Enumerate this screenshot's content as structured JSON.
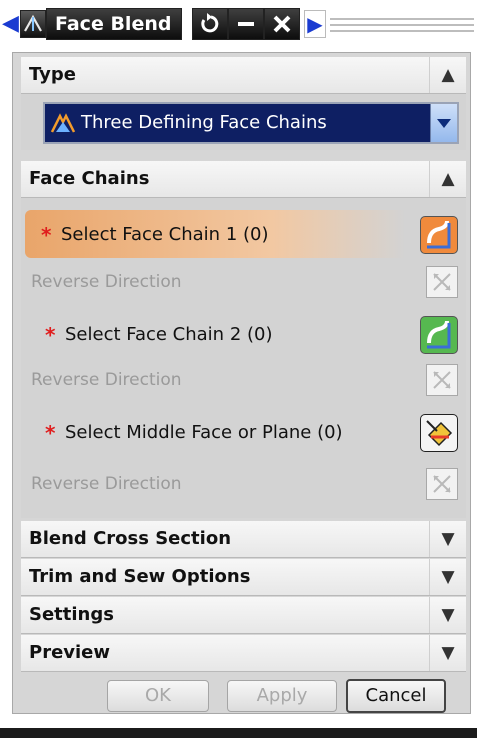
{
  "window": {
    "title": "Face Blend",
    "back_icon": "chevron-left-icon",
    "more_icon": "chevron-right-icon",
    "buttons": [
      "reset-icon",
      "minimize-icon",
      "close-icon"
    ]
  },
  "sections": {
    "type": {
      "label": "Type",
      "expanded": true,
      "dropdown": {
        "value": "Three Defining Face Chains",
        "icon": "face-blend-icon"
      }
    },
    "face_chains": {
      "label": "Face Chains",
      "expanded": true,
      "chain1": {
        "label": "Select Face Chain 1 (0)",
        "required_mark": "*",
        "active": true
      },
      "reverse1": {
        "label": "Reverse Direction"
      },
      "chain2": {
        "label": "Select Face Chain 2 (0)",
        "required_mark": "*"
      },
      "reverse2": {
        "label": "Reverse Direction"
      },
      "middle": {
        "label": "Select Middle Face or Plane (0)",
        "required_mark": "*"
      },
      "reverse3": {
        "label": "Reverse Direction"
      }
    },
    "collapsed": [
      {
        "label": "Blend Cross Section"
      },
      {
        "label": "Trim and Sew Options"
      },
      {
        "label": "Settings"
      },
      {
        "label": "Preview"
      }
    ]
  },
  "actions": {
    "ok": "OK",
    "apply": "Apply",
    "cancel": "Cancel"
  },
  "colors": {
    "accent_highlight": "#e9a56a",
    "dropdown_bg": "#0e1f63",
    "required": "#e01d1d"
  }
}
